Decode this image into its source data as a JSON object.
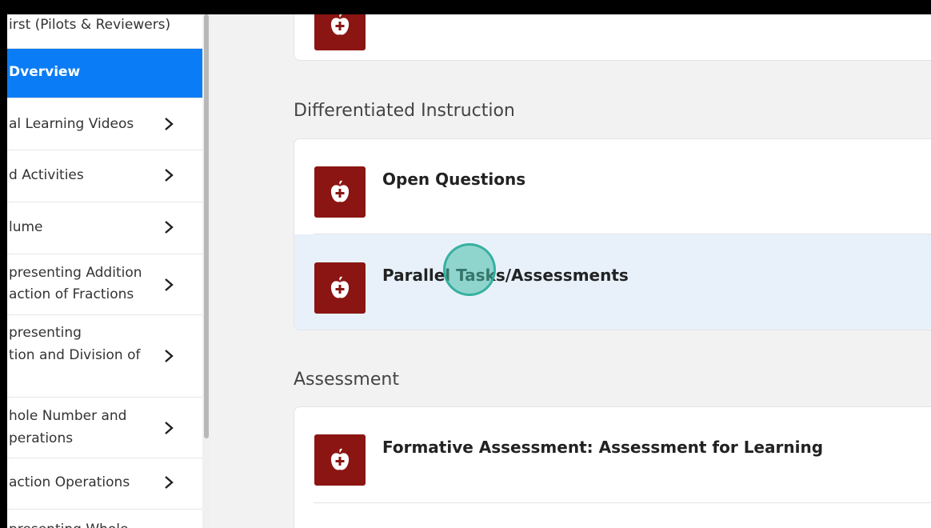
{
  "sidebar": {
    "items": [
      {
        "label": "irst (Pilots & Reviewers)",
        "chevron": false,
        "active": false
      },
      {
        "label": "Dverview",
        "chevron": false,
        "active": true
      },
      {
        "label": "al Learning Videos",
        "chevron": true,
        "active": false
      },
      {
        "label": "d Activities",
        "chevron": true,
        "active": false
      },
      {
        "label": "lume",
        "chevron": true,
        "active": false
      },
      {
        "label": "presenting Addition",
        "label2": "action of Fractions",
        "chevron": true,
        "active": false
      },
      {
        "label": "presenting",
        "label2": "tion and Division of",
        "chevron": true,
        "active": false
      },
      {
        "label": "hole Number and",
        "label2": "perations",
        "chevron": true,
        "active": false
      },
      {
        "label": "action Operations",
        "chevron": true,
        "active": false
      },
      {
        "label": "presenting Whole",
        "chevron": true,
        "active": false
      }
    ]
  },
  "main": {
    "sections": [
      {
        "heading": "Differentiated Instruction",
        "rows": [
          {
            "title": "Open Questions",
            "icon": "apple-plus-icon"
          },
          {
            "title": "Parallel Tasks/Assessments",
            "icon": "apple-plus-icon"
          }
        ]
      },
      {
        "heading": "Assessment",
        "rows": [
          {
            "title": "Formative Assessment: Assessment for Learning",
            "icon": "apple-plus-icon"
          }
        ]
      }
    ]
  },
  "colors": {
    "active_blue": "#0a7cf5",
    "icon_red": "#8b1512",
    "highlight_row": "#e8f1fa",
    "cursor_teal": "#46beaa"
  }
}
